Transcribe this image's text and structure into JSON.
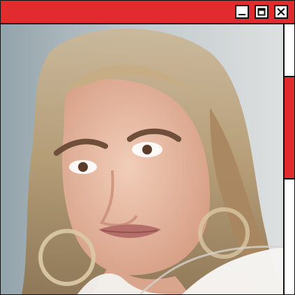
{
  "window": {
    "title": "",
    "controls": {
      "minimize_icon": "minimize-icon",
      "maximize_icon": "maximize-icon",
      "close_icon": "close-icon"
    },
    "colors": {
      "titlebar": "#e12b2f",
      "scroll_thumb": "#e12b2f",
      "border": "#111111"
    }
  },
  "content": {
    "image": "portrait-photo"
  },
  "scrollbar": {
    "thumb_start_fraction": 0.19,
    "thumb_size_fraction": 0.385
  }
}
